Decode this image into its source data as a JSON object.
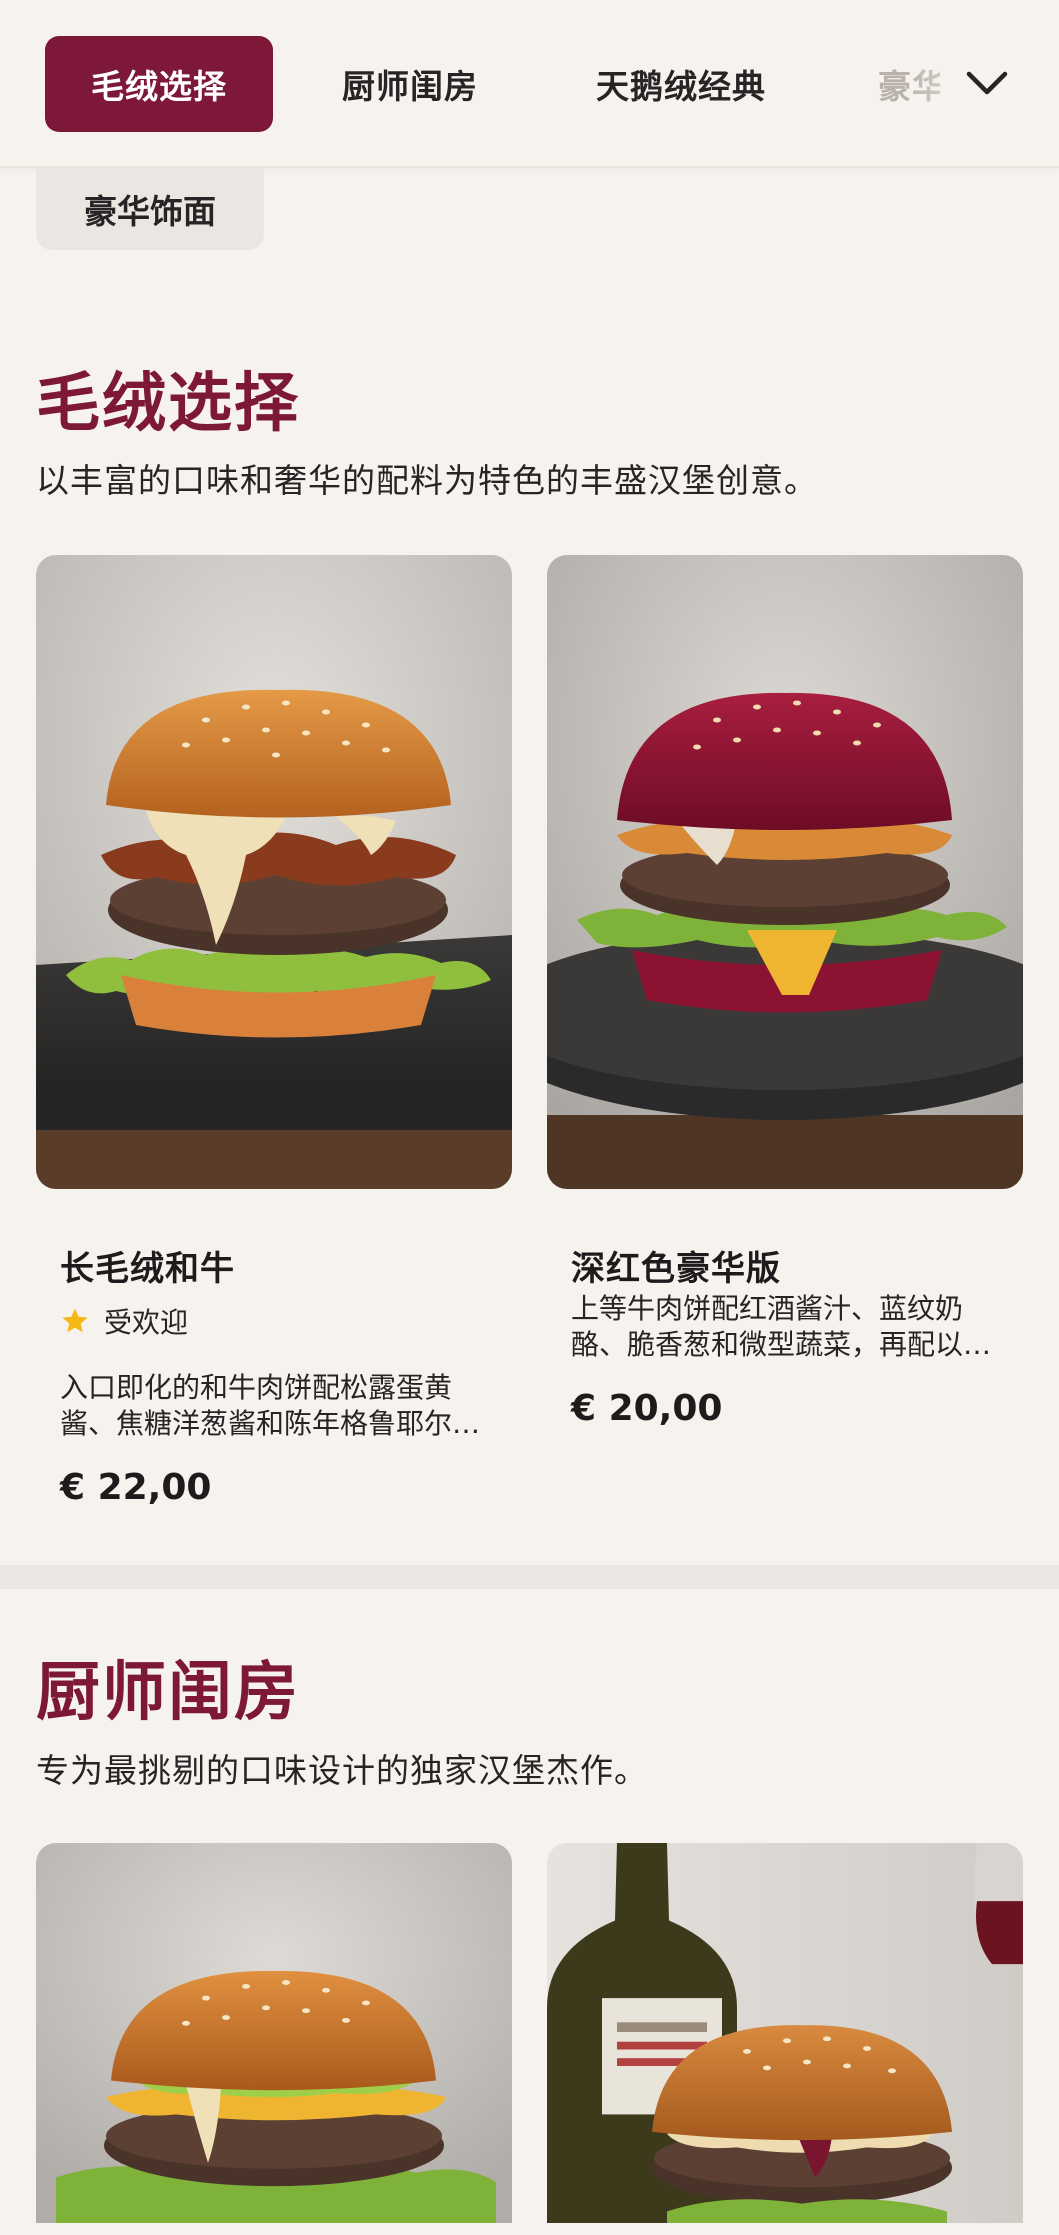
{
  "tabs": [
    {
      "label": "毛绒选择"
    },
    {
      "label": "厨师闺房"
    },
    {
      "label": "天鹅绒经典"
    },
    {
      "label": "豪华饰面"
    }
  ],
  "overflow_chip": {
    "label": "豪华饰面"
  },
  "chevron_icon": "chevron-down-icon",
  "accent_color": "#7d1838",
  "sections": [
    {
      "title": "毛绒选择",
      "description": "以丰富的口味和奢华的配料为特色的丰盛汉堡创意。",
      "items": [
        {
          "name": "长毛绒和牛",
          "badge": "受欢迎",
          "badge_icon": "star-icon",
          "description": "入口即化的和牛肉饼配松露蛋黄酱、焦糖洋葱酱和陈年格鲁耶尔奶酪，盛在金黄奶油面包中。",
          "price": "€ 22,00"
        },
        {
          "name": "深红色豪华版",
          "description": "上等牛肉饼配红酒酱汁、蓝纹奶酪、脆香葱和微型蔬菜，再配以深红色甜菜根面包。",
          "price": "€ 20,00"
        }
      ]
    },
    {
      "title": "厨师闺房",
      "description": "专为最挑剔的口味设计的独家汉堡杰作。",
      "items": [
        {
          "name": "",
          "description": "",
          "price": ""
        },
        {
          "name": "",
          "description": "",
          "price": ""
        }
      ]
    }
  ]
}
